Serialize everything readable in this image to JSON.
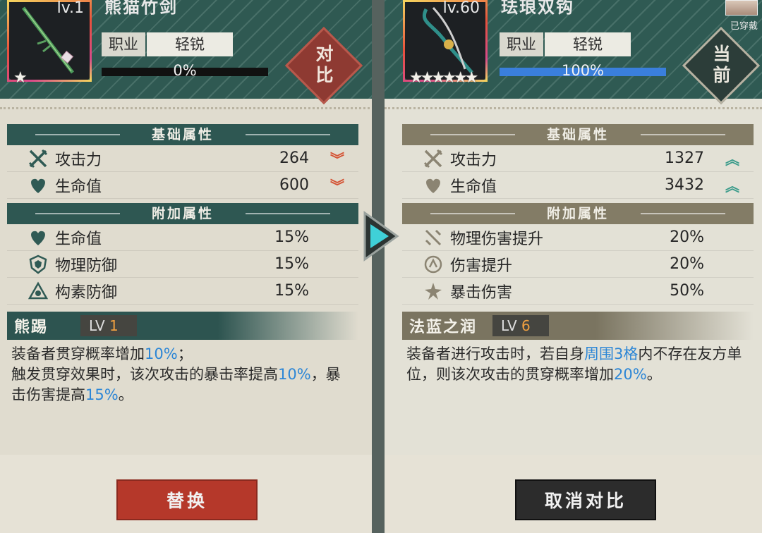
{
  "left": {
    "level": "lv.1",
    "weapon_name": "熊猫竹剑",
    "job_key": "职业",
    "job_value": "轻锐",
    "progress_label": "0%",
    "progress": 0,
    "stars": "★",
    "compare_badge": [
      "对",
      "比"
    ],
    "base_header": "基础属性",
    "base": [
      {
        "name": "攻击力",
        "value": "264",
        "icon": "crossed-swords-icon",
        "trend": "down"
      },
      {
        "name": "生命值",
        "value": "600",
        "icon": "heart-icon",
        "trend": "down"
      }
    ],
    "extra_header": "附加属性",
    "extra": [
      {
        "name": "生命值",
        "value": "15%",
        "icon": "heart-icon"
      },
      {
        "name": "物理防御",
        "value": "15%",
        "icon": "shield-icon"
      },
      {
        "name": "构素防御",
        "value": "15%",
        "icon": "element-shield-icon"
      }
    ],
    "skill_name": "熊踢",
    "skill_lv_prefix": "LV",
    "skill_lv": "1",
    "desc": [
      {
        "t": "装备者贯穿概率增加"
      },
      {
        "t": "10%",
        "hl": true
      },
      {
        "t": "；\n触发贯穿效果时，该次攻击的暴击率提高"
      },
      {
        "t": "10%",
        "hl": true
      },
      {
        "t": "，暴击伤害提高"
      },
      {
        "t": "15%",
        "hl": true
      },
      {
        "t": "。"
      }
    ],
    "button": "替换"
  },
  "right": {
    "level": "lv.60",
    "weapon_name": "珐琅双钩",
    "worn_label": "已穿戴",
    "job_key": "职业",
    "job_value": "轻锐",
    "progress_label": "100%",
    "progress": 100,
    "stars": "★★★★★★",
    "current_badge": [
      "当",
      "前"
    ],
    "base_header": "基础属性",
    "base": [
      {
        "name": "攻击力",
        "value": "1327",
        "icon": "crossed-swords-icon",
        "trend": "up"
      },
      {
        "name": "生命值",
        "value": "3432",
        "icon": "heart-icon",
        "trend": "up"
      }
    ],
    "extra_header": "附加属性",
    "extra": [
      {
        "name": "物理伤害提升",
        "value": "20%",
        "icon": "physical-damage-icon"
      },
      {
        "name": "伤害提升",
        "value": "20%",
        "icon": "damage-up-icon"
      },
      {
        "name": "暴击伤害",
        "value": "50%",
        "icon": "crit-damage-icon"
      }
    ],
    "skill_name": "法蓝之润",
    "skill_lv_prefix": "LV",
    "skill_lv": "6",
    "desc": [
      {
        "t": "装备者进行攻击时，若自身"
      },
      {
        "t": "周围3格",
        "hl": true
      },
      {
        "t": "内不存在友方单位，则该次攻击的贯穿概率增加"
      },
      {
        "t": "20%",
        "hl": true
      },
      {
        "t": "。"
      }
    ],
    "button": "取消对比"
  },
  "colors": {
    "down": "#d45233",
    "up": "#3a9b8a",
    "highlight": "#2c86d6",
    "skill_lv": "#f0a040"
  }
}
